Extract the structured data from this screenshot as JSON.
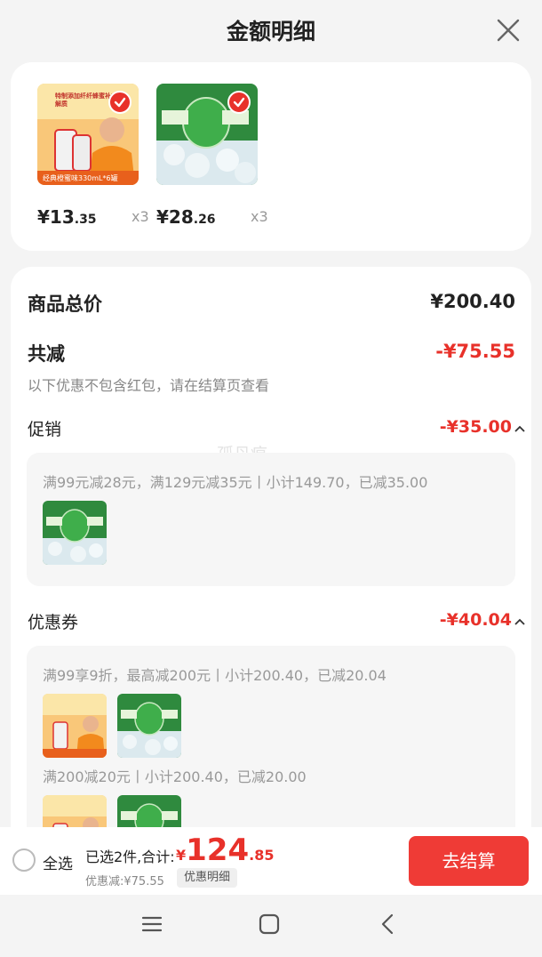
{
  "header": {
    "title": "金额明细"
  },
  "products": [
    {
      "banner_text_top": "特制添加纤纤蜂蜜补充电解质",
      "banner_text_bottom": "经典橙蜜味330mL*6罐",
      "price_int": "¥13",
      "price_dec": ".35",
      "qty": "x3"
    },
    {
      "banner_text_top": "",
      "banner_text_bottom": "",
      "price_int": "¥28",
      "price_dec": ".26",
      "qty": "x3"
    }
  ],
  "detail": {
    "total_label": "商品总价",
    "total_value": "¥200.40",
    "reduce_label": "共减",
    "reduce_value": "-¥75.55",
    "reduce_note": "以下优惠不包含红包，请在结算页查看",
    "promo_label": "促销",
    "promo_value": "-¥35.00",
    "promo_line": "满99元减28元，满129元减35元丨小计149.70，已减35.00",
    "coupon_label": "优惠券",
    "coupon_value": "-¥40.04",
    "coupon_line1": "满99享9折，最高减200元丨小计200.40，已减20.04",
    "coupon_line2": "满200减20元丨小计200.40，已减20.00",
    "watermark": "孤丹痕"
  },
  "bottom": {
    "select_all": "全选",
    "summary": "已选2件,合计:",
    "total_cur": "¥",
    "total_int": "124",
    "total_dec": ".85",
    "discount": "优惠减:¥75.55",
    "detail_button": "优惠明细",
    "checkout": "去结算"
  },
  "colors": {
    "accent": "#e8312a",
    "checkout": "#ef3b36"
  }
}
